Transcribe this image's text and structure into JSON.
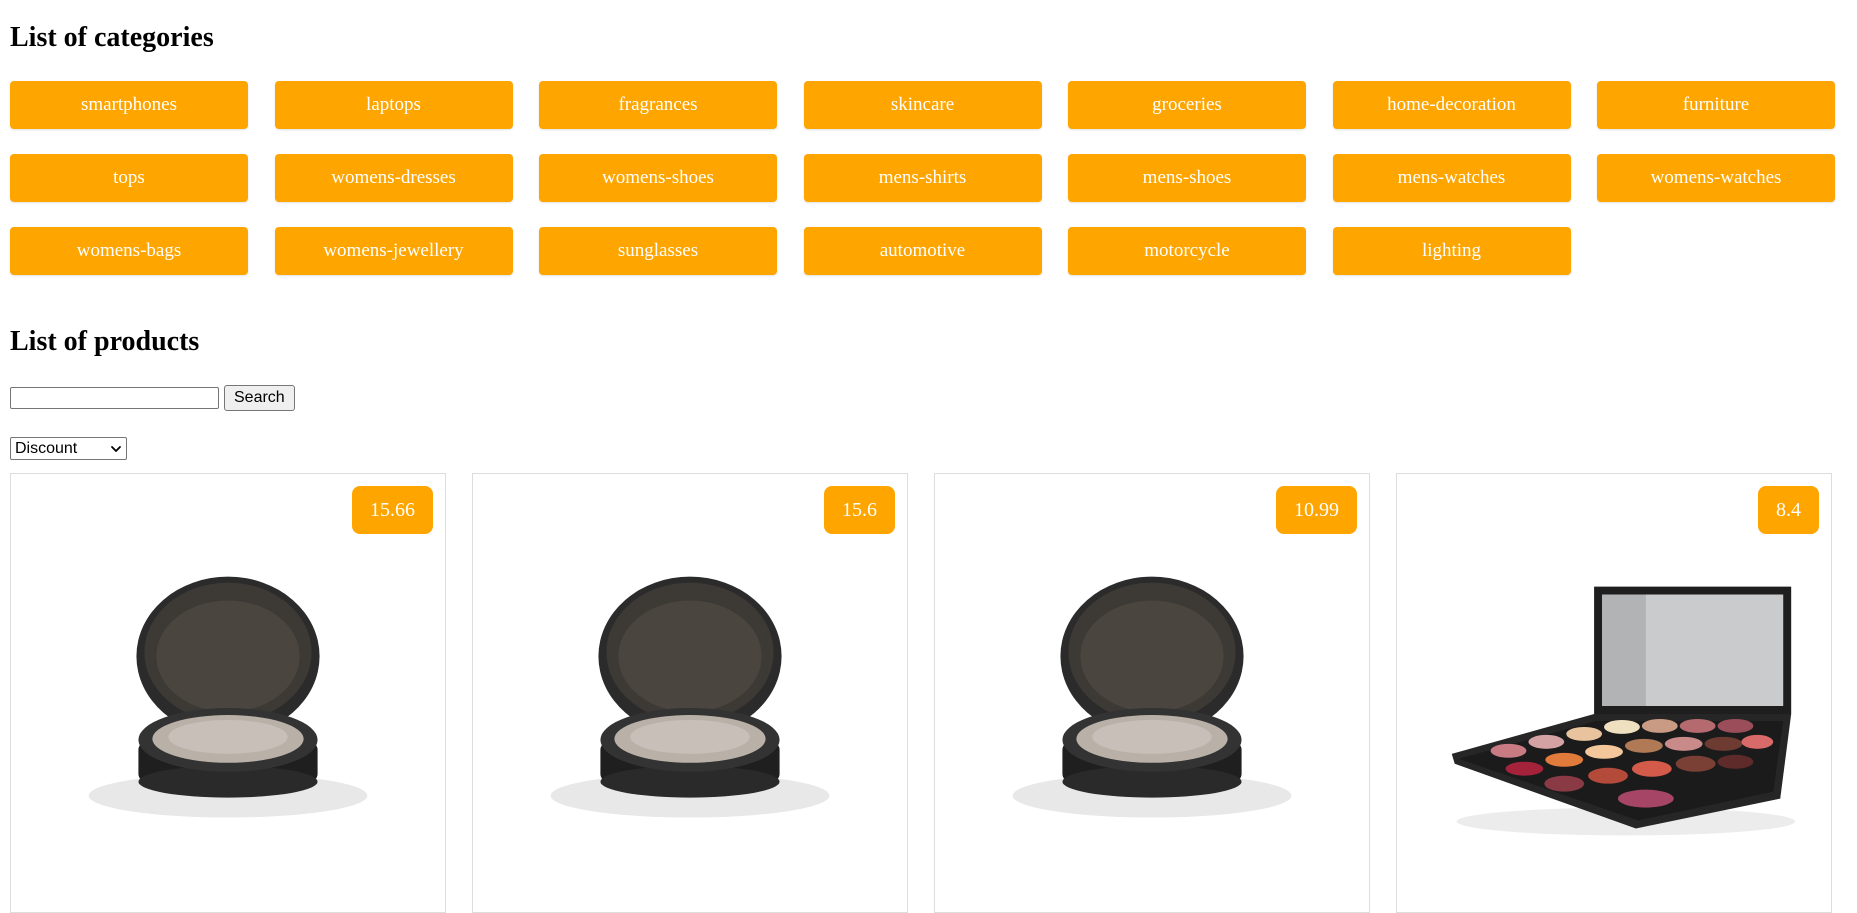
{
  "categories": {
    "heading": "List of categories",
    "items": [
      "smartphones",
      "laptops",
      "fragrances",
      "skincare",
      "groceries",
      "home-decoration",
      "furniture",
      "tops",
      "womens-dresses",
      "womens-shoes",
      "mens-shirts",
      "mens-shoes",
      "mens-watches",
      "womens-watches",
      "womens-bags",
      "womens-jewellery",
      "sunglasses",
      "automotive",
      "motorcycle",
      "lighting"
    ]
  },
  "products": {
    "heading": "List of products",
    "search": {
      "value": "",
      "placeholder": "",
      "button_label": "Search"
    },
    "sort": {
      "selected": "Discount"
    },
    "cards": [
      {
        "discount": "15.66",
        "image": "compact-powder"
      },
      {
        "discount": "15.6",
        "image": "compact-powder"
      },
      {
        "discount": "10.99",
        "image": "compact-powder"
      },
      {
        "discount": "8.4",
        "image": "eyeshadow-palette"
      }
    ]
  },
  "colors": {
    "accent": "#ffa500",
    "border": "#dddddd"
  },
  "icons": {
    "select_arrow": "chevron-down-icon"
  }
}
